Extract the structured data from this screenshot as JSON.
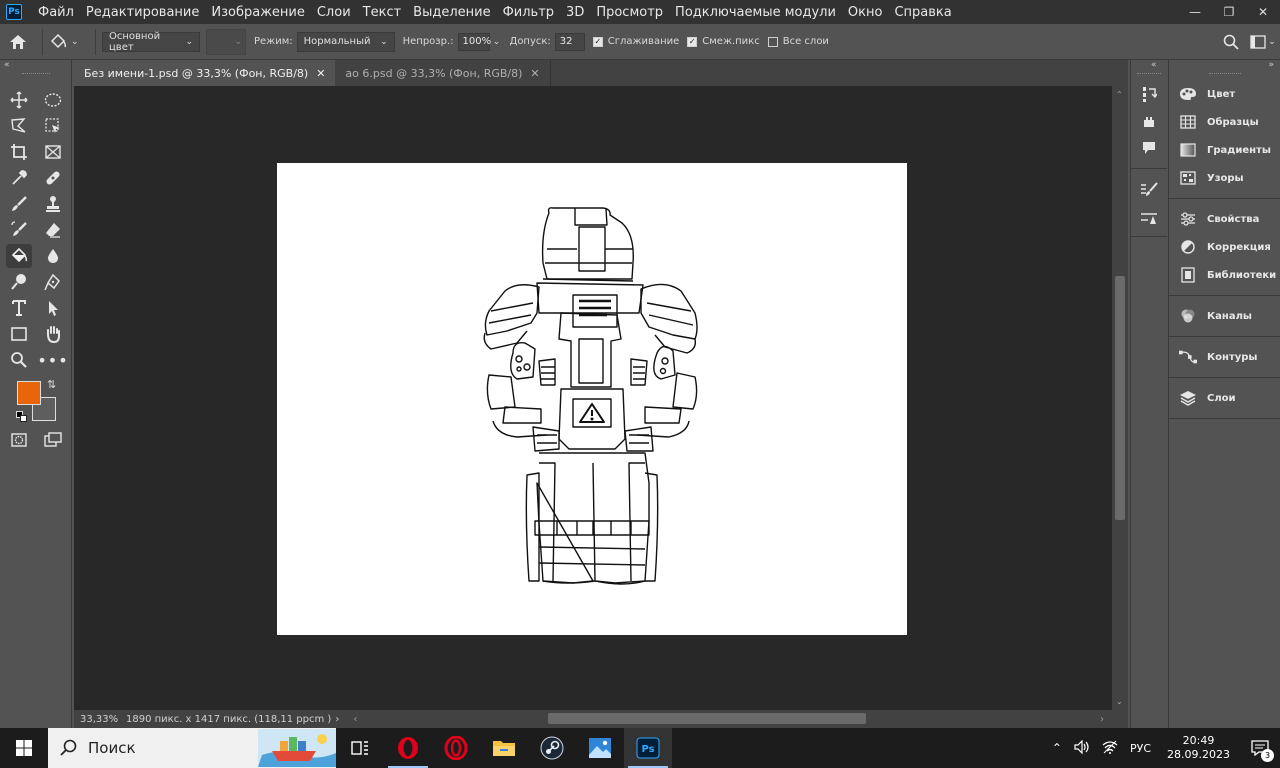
{
  "menubar": {
    "logo": "Ps",
    "items": [
      "Файл",
      "Редактирование",
      "Изображение",
      "Слои",
      "Текст",
      "Выделение",
      "Фильтр",
      "3D",
      "Просмотр",
      "Подключаемые модули",
      "Окно",
      "Справка"
    ]
  },
  "options": {
    "fill_source": "Основной цвет",
    "mode_label": "Режим:",
    "mode_value": "Нормальный",
    "opacity_label": "Непрозр.:",
    "opacity_value": "100%",
    "tolerance_label": "Допуск:",
    "tolerance_value": "32",
    "antialias_label": "Сглаживание",
    "antialias_checked": true,
    "contiguous_label": "Смеж.пикс",
    "contiguous_checked": true,
    "all_layers_label": "Все слои",
    "all_layers_checked": false
  },
  "tabs": [
    {
      "label": "Без имени-1.psd @ 33,3% (Фон, RGB/8)",
      "active": true
    },
    {
      "label": "ao 6.psd @ 33,3% (Фон, RGB/8)",
      "active": false
    }
  ],
  "colors": {
    "foreground": "#e8650a",
    "background": "#5e5e5e",
    "ps_blue": "#31a8ff"
  },
  "status": {
    "zoom": "33,33%",
    "doc_info": "1890 пикс. x 1417 пикс. (118,11 ppcm )"
  },
  "panels": [
    {
      "label": "Цвет",
      "icon": "palette-icon"
    },
    {
      "label": "Образцы",
      "icon": "grid-swatches-icon"
    },
    {
      "label": "Градиенты",
      "icon": "gradient-icon"
    },
    {
      "label": "Узоры",
      "icon": "pattern-icon"
    },
    {
      "label": "Свойства",
      "icon": "sliders-icon"
    },
    {
      "label": "Коррекция",
      "icon": "adjustment-circle-icon"
    },
    {
      "label": "Библиотеки",
      "icon": "library-icon"
    },
    {
      "label": "Каналы",
      "icon": "channels-icon"
    },
    {
      "label": "Контуры",
      "icon": "paths-icon"
    },
    {
      "label": "Слои",
      "icon": "layers-icon"
    }
  ],
  "taskbar": {
    "search_placeholder": "Поиск",
    "lang": "РУС",
    "time": "20:49",
    "date": "28.09.2023",
    "notifications": "3"
  }
}
